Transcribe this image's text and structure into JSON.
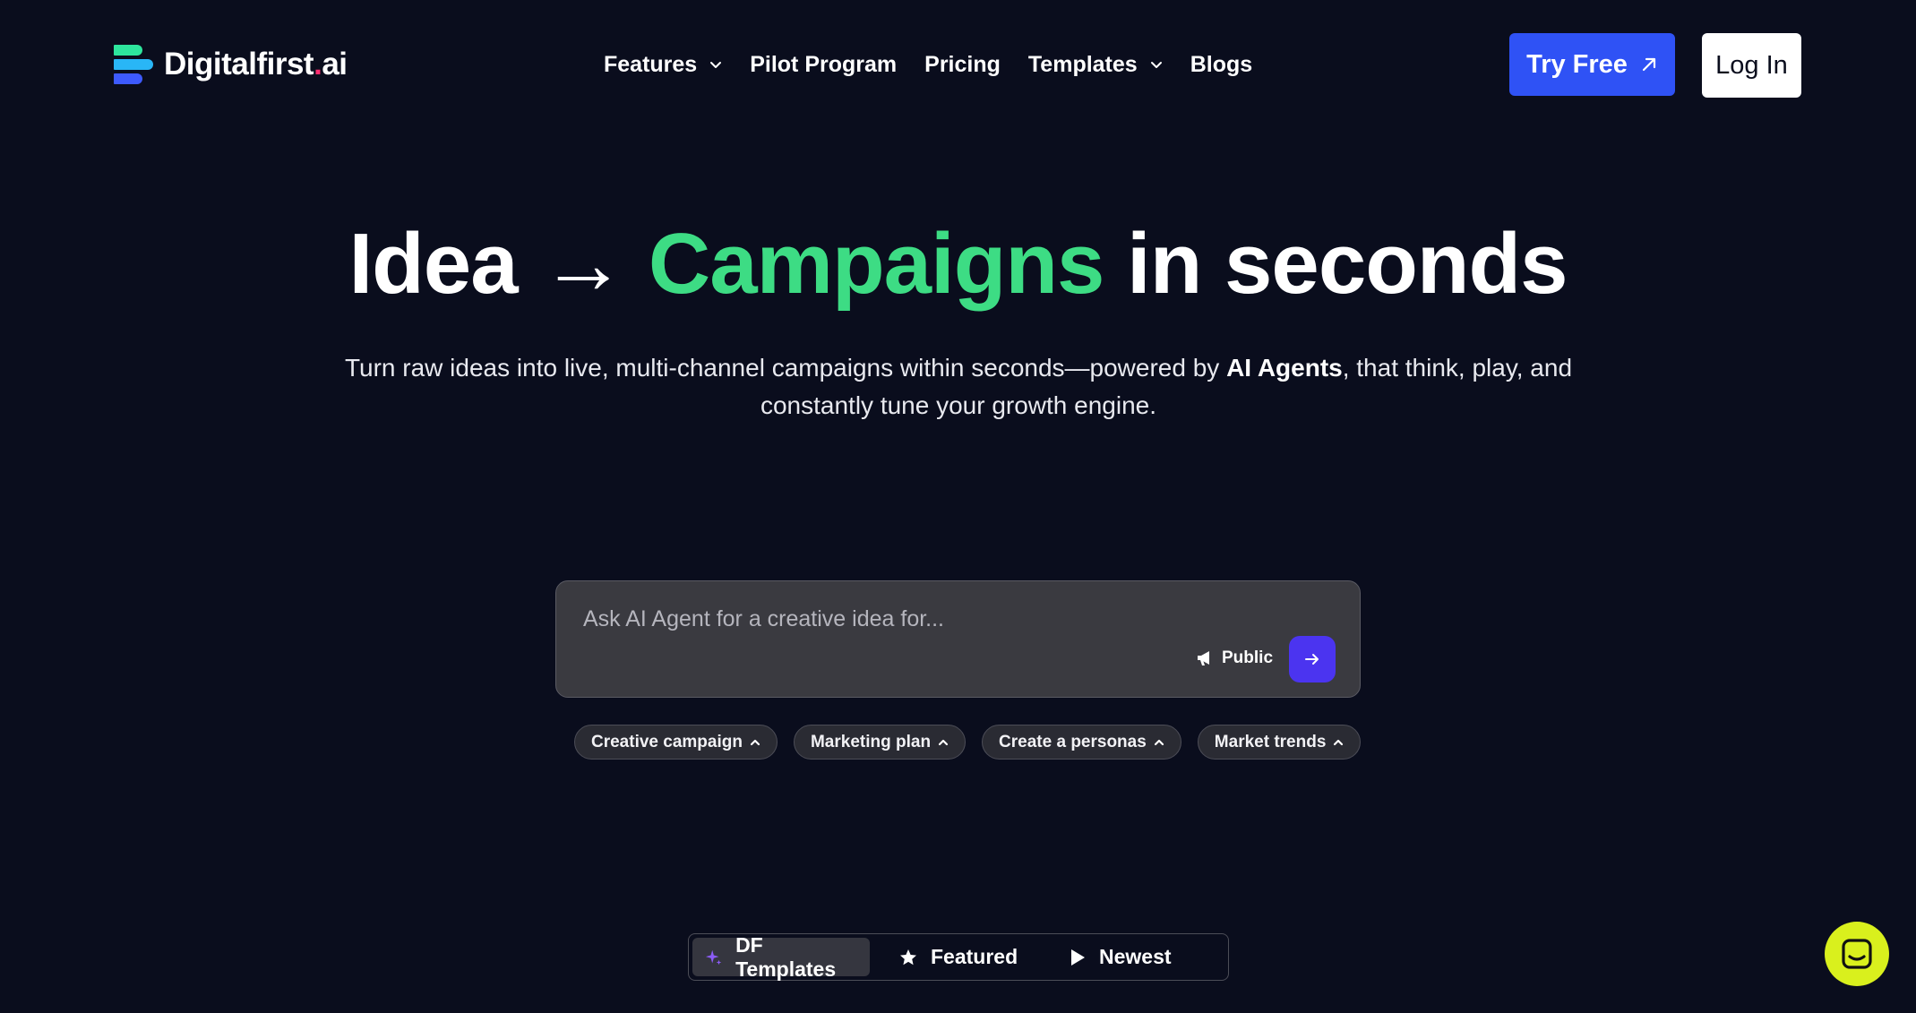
{
  "brand": {
    "name_main": "Digitalfirst",
    "name_dot": ".",
    "name_tld": "ai",
    "logo_colors": [
      "#2ee59d",
      "#29b6f6",
      "#3d5afe"
    ]
  },
  "nav": {
    "items": [
      {
        "label": "Features",
        "has_dropdown": true
      },
      {
        "label": "Pilot Program",
        "has_dropdown": false
      },
      {
        "label": "Pricing",
        "has_dropdown": false
      },
      {
        "label": "Templates",
        "has_dropdown": true
      },
      {
        "label": "Blogs",
        "has_dropdown": false
      }
    ],
    "try_free_label": "Try Free",
    "login_label": "Log In"
  },
  "hero": {
    "title_part1": "Idea → ",
    "title_accent": "Campaigns",
    "title_part2": " in seconds",
    "subtitle_part1": "Turn raw ideas into live, multi-channel campaigns within seconds—powered by ",
    "subtitle_bold": "AI Agents",
    "subtitle_part2": ", that think, play, and constantly tune your growth engine."
  },
  "prompt": {
    "placeholder": "Ask AI Agent for a creative idea for...",
    "value": "",
    "visibility_label": "Public"
  },
  "chips": [
    {
      "label": "Creative campaign"
    },
    {
      "label": "Marketing plan"
    },
    {
      "label": "Create a personas"
    },
    {
      "label": "Market trends"
    }
  ],
  "tabs": [
    {
      "label": "DF Templates",
      "icon": "sparkle-icon",
      "active": true
    },
    {
      "label": "Featured",
      "icon": "star-icon",
      "active": false
    },
    {
      "label": "Newest",
      "icon": "play-icon",
      "active": false
    }
  ],
  "colors": {
    "background": "#0a0d1d",
    "accent_green": "#3ddc84",
    "primary_blue": "#2f52f5",
    "send_purple": "#4b34f0",
    "chat_yellow": "#d9f01d",
    "logo_dot": "#ff2d6f"
  }
}
